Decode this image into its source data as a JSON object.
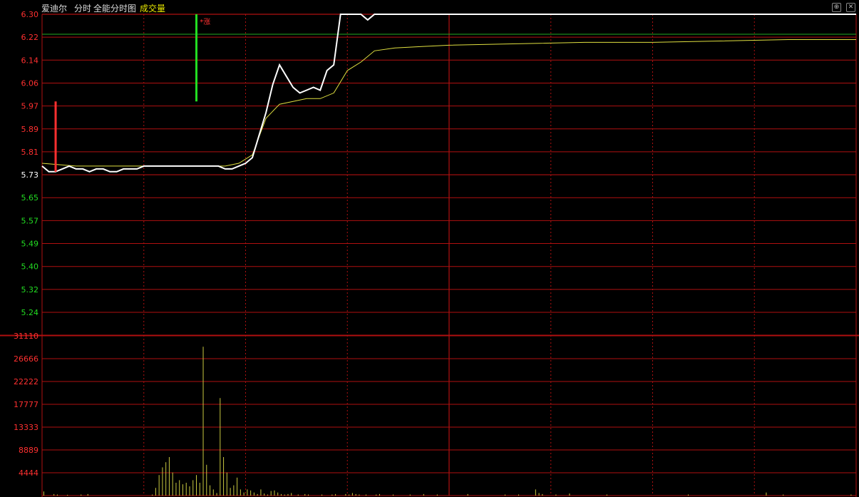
{
  "header": {
    "stock_name": "爱迪尔",
    "mode_intraday": "分时",
    "mode_full": "全能分时图",
    "indicator": "成交量",
    "btn_up": "⊕",
    "btn_close": "✕"
  },
  "colors": {
    "grid": "#b01010",
    "up": "#ff3030",
    "down": "#22dd22",
    "price_line": "#ffffff",
    "avg_line": "#e0e040",
    "volume": "#c8c840",
    "limit_line": "#22aa22",
    "header_text": "#dddddd",
    "indicator_text": "#e8e800"
  },
  "price_axis": {
    "up_labels": [
      "6.30",
      "6.22",
      "6.14",
      "6.06",
      "5.97",
      "5.89",
      "5.81"
    ],
    "base_label": "5.73",
    "down_labels": [
      "5.65",
      "5.57",
      "5.49",
      "5.40",
      "5.32",
      "5.24"
    ]
  },
  "volume_axis": {
    "labels": [
      "31110",
      "26666",
      "22222",
      "17777",
      "13333",
      "8889",
      "4444"
    ]
  },
  "annotations": {
    "limit_up_mark": "*涨"
  },
  "chart_data": {
    "type": "line",
    "price": {
      "ylim": [
        5.24,
        6.3
      ],
      "prev_close": 5.73,
      "limit_up": 6.3,
      "series": [
        {
          "x": [
            0,
            2,
            4,
            6,
            8,
            10,
            12,
            14,
            16,
            18,
            20,
            22,
            24,
            26,
            28,
            30,
            32,
            34,
            36,
            38,
            40,
            42,
            44,
            46,
            48,
            50,
            52,
            54,
            56,
            58,
            60,
            62,
            64,
            66,
            68,
            70,
            72,
            74,
            76,
            78,
            80,
            82,
            84,
            86,
            88,
            90,
            92,
            94,
            96,
            98,
            100,
            104,
            108,
            112,
            116,
            120,
            130,
            140,
            150,
            160,
            170,
            180,
            190,
            200,
            210,
            220,
            230,
            240
          ],
          "y": [
            5.76,
            5.74,
            5.74,
            5.75,
            5.76,
            5.75,
            5.75,
            5.74,
            5.75,
            5.75,
            5.74,
            5.74,
            5.75,
            5.75,
            5.75,
            5.76,
            5.76,
            5.76,
            5.76,
            5.76,
            5.76,
            5.76,
            5.76,
            5.76,
            5.76,
            5.76,
            5.76,
            5.75,
            5.75,
            5.76,
            5.77,
            5.79,
            5.87,
            5.95,
            6.05,
            6.12,
            6.08,
            6.04,
            6.02,
            6.03,
            6.04,
            6.03,
            6.1,
            6.12,
            6.3,
            6.3,
            6.3,
            6.3,
            6.28,
            6.3,
            6.3,
            6.3,
            6.3,
            6.3,
            6.3,
            6.3,
            6.3,
            6.3,
            6.3,
            6.3,
            6.3,
            6.3,
            6.3,
            6.3,
            6.3,
            6.3,
            6.3,
            6.3
          ]
        },
        {
          "x": [
            0,
            10,
            20,
            30,
            40,
            50,
            54,
            58,
            62,
            66,
            70,
            74,
            78,
            82,
            86,
            90,
            94,
            98,
            104,
            112,
            120,
            140,
            160,
            180,
            200,
            220,
            240
          ],
          "y": [
            5.77,
            5.76,
            5.76,
            5.76,
            5.76,
            5.76,
            5.76,
            5.77,
            5.8,
            5.93,
            5.98,
            5.99,
            6.0,
            6.0,
            6.02,
            6.1,
            6.13,
            6.17,
            6.18,
            6.185,
            6.19,
            6.195,
            6.2,
            6.2,
            6.205,
            6.21,
            6.21
          ]
        }
      ],
      "bar_marks": [
        {
          "x": 4,
          "low": 5.74,
          "high": 5.99,
          "direction": "up"
        },
        {
          "x": 45.5,
          "low": 5.99,
          "high": 6.3,
          "direction": "down"
        }
      ]
    },
    "volume": {
      "ylim": [
        0,
        31110
      ],
      "values": [
        800,
        0,
        0,
        300,
        200,
        0,
        0,
        150,
        0,
        0,
        0,
        200,
        0,
        300,
        0,
        0,
        0,
        0,
        0,
        0,
        0,
        0,
        0,
        0,
        0,
        0,
        0,
        0,
        0,
        0,
        0,
        0,
        200,
        1500,
        4000,
        5500,
        6500,
        7500,
        4500,
        2500,
        3000,
        2200,
        2500,
        1800,
        3000,
        4000,
        2500,
        29000,
        6000,
        2000,
        1200,
        500,
        19000,
        7500,
        4500,
        1500,
        2000,
        3500,
        1200,
        600,
        1200,
        1000,
        600,
        300,
        1200,
        400,
        200,
        900,
        1000,
        600,
        300,
        200,
        300,
        500,
        0,
        200,
        0,
        300,
        200,
        0,
        0,
        0,
        200,
        0,
        0,
        200,
        300,
        0,
        0,
        300,
        200,
        500,
        300,
        200,
        0,
        200,
        0,
        0,
        200,
        300,
        0,
        0,
        0,
        200,
        0,
        0,
        0,
        0,
        200,
        0,
        0,
        0,
        300,
        0,
        0,
        0,
        200,
        0,
        0,
        0,
        0,
        0,
        0,
        0,
        0,
        300,
        0,
        0,
        0,
        0,
        0,
        0,
        0,
        0,
        0,
        0,
        200,
        0,
        0,
        0,
        200,
        0,
        0,
        0,
        0,
        1200,
        500,
        300,
        0,
        0,
        0,
        200,
        0,
        0,
        0,
        400,
        0,
        0,
        0,
        0,
        0,
        0,
        0,
        0,
        0,
        0,
        200,
        0,
        0,
        0,
        0,
        0,
        0,
        0,
        0,
        0,
        0,
        0,
        0,
        0,
        0,
        0,
        0,
        0,
        0,
        0,
        0,
        0,
        0,
        0,
        200,
        0,
        0,
        0,
        0,
        0,
        0,
        0,
        0,
        0,
        0,
        0,
        0,
        0,
        0,
        0,
        0,
        0,
        0,
        0,
        0,
        0,
        0,
        600,
        0,
        0,
        0,
        0,
        200,
        0,
        0,
        0,
        0,
        0,
        0,
        0,
        0,
        0,
        0,
        0,
        0,
        0,
        0,
        0,
        0,
        0,
        0,
        0,
        200,
        0,
        0,
        0,
        0,
        0,
        0,
        0,
        0,
        0,
        0,
        0,
        0,
        0,
        0,
        0,
        0,
        0,
        0,
        0,
        0
      ]
    }
  }
}
